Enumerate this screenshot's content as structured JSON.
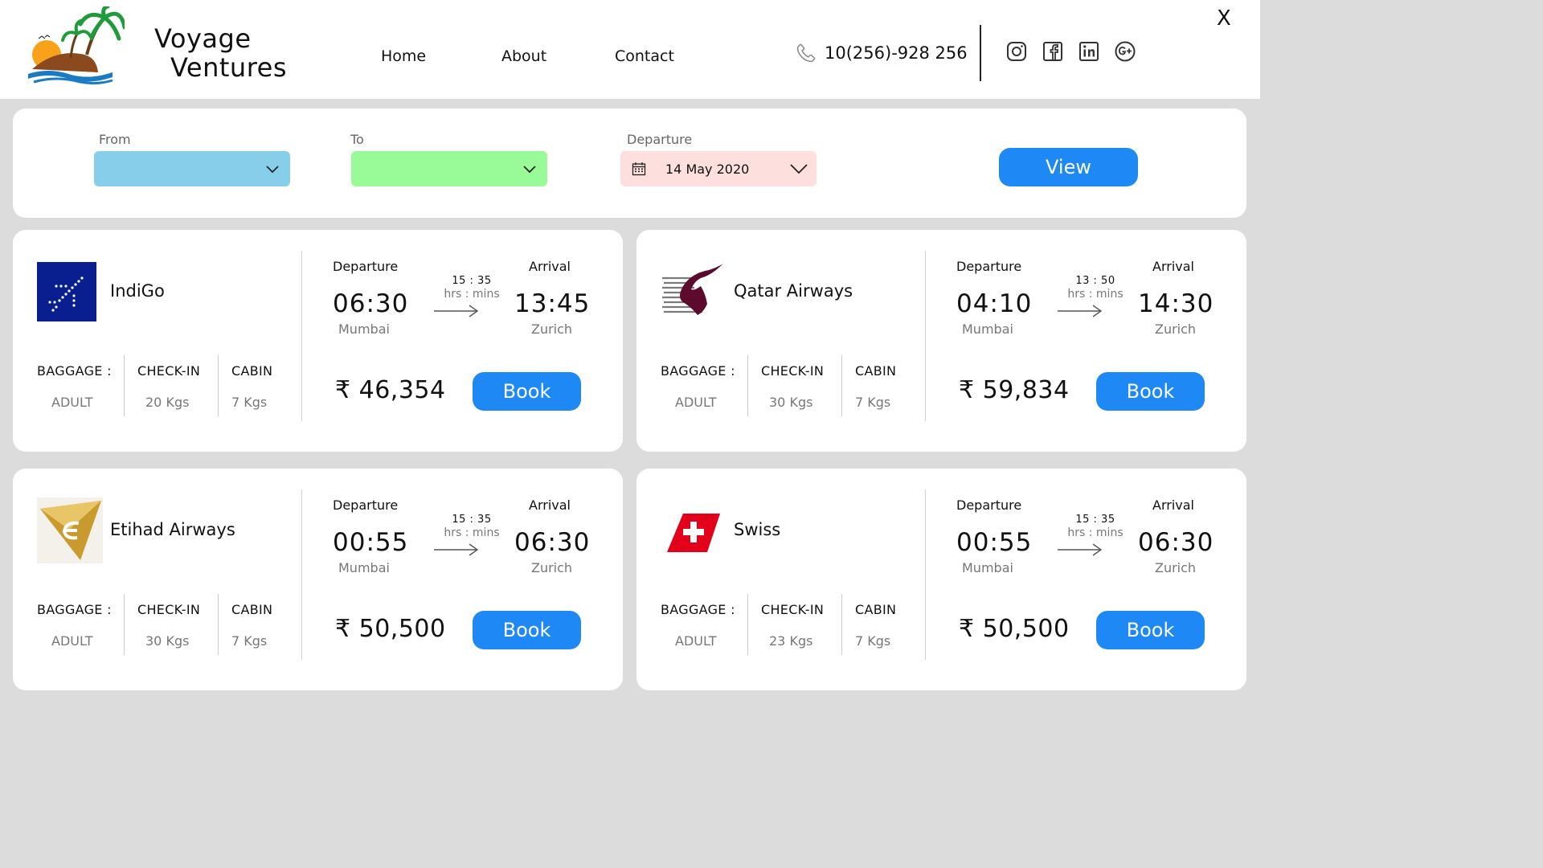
{
  "header": {
    "brand_line1": "Voyage",
    "brand_line2": "Ventures",
    "nav": [
      "Home",
      "About",
      "Contact"
    ],
    "phone": "10(256)-928 256",
    "close_label": "X",
    "social_icons": [
      "instagram-icon",
      "facebook-icon",
      "linkedin-icon",
      "google-plus-icon"
    ]
  },
  "search": {
    "from_label": "From",
    "to_label": "To",
    "departure_label": "Departure",
    "departure_value": "14 May 2020",
    "view_label": "View",
    "colors": {
      "from": "#87ceeb",
      "to": "#98fb98",
      "departure": "#fde0dd",
      "button": "#1e88f5"
    }
  },
  "labels": {
    "departure": "Departure",
    "arrival": "Arrival",
    "duration_units": "hrs : mins",
    "baggage": "BAGGAGE :",
    "checkin": "CHECK-IN",
    "cabin": "CABIN",
    "adult": "ADULT",
    "book": "Book"
  },
  "flights": [
    {
      "airline": "IndiGo",
      "logo": "indigo-logo",
      "dep_time": "06:30",
      "arr_time": "13:45",
      "duration": "15 : 35",
      "from_city": "Mumbai",
      "to_city": "Zurich",
      "checkin": "20 Kgs",
      "cabin": "7 Kgs",
      "price": "₹ 46,354"
    },
    {
      "airline": "Qatar Airways",
      "logo": "qatar-logo",
      "dep_time": "04:10",
      "arr_time": "14:30",
      "duration": "13 : 50",
      "from_city": "Mumbai",
      "to_city": "Zurich",
      "checkin": "30 Kgs",
      "cabin": "7 Kgs",
      "price": "₹ 59,834"
    },
    {
      "airline": "Etihad Airways",
      "logo": "etihad-logo",
      "dep_time": "00:55",
      "arr_time": "06:30",
      "duration": "15 : 35",
      "from_city": "Mumbai",
      "to_city": "Zurich",
      "checkin": "30 Kgs",
      "cabin": "7 Kgs",
      "price": "₹ 50,500"
    },
    {
      "airline": "Swiss",
      "logo": "swiss-logo",
      "dep_time": "00:55",
      "arr_time": "06:30",
      "duration": "15 : 35",
      "from_city": "Mumbai",
      "to_city": "Zurich",
      "checkin": "23 Kgs",
      "cabin": "7 Kgs",
      "price": "₹ 50,500"
    }
  ]
}
